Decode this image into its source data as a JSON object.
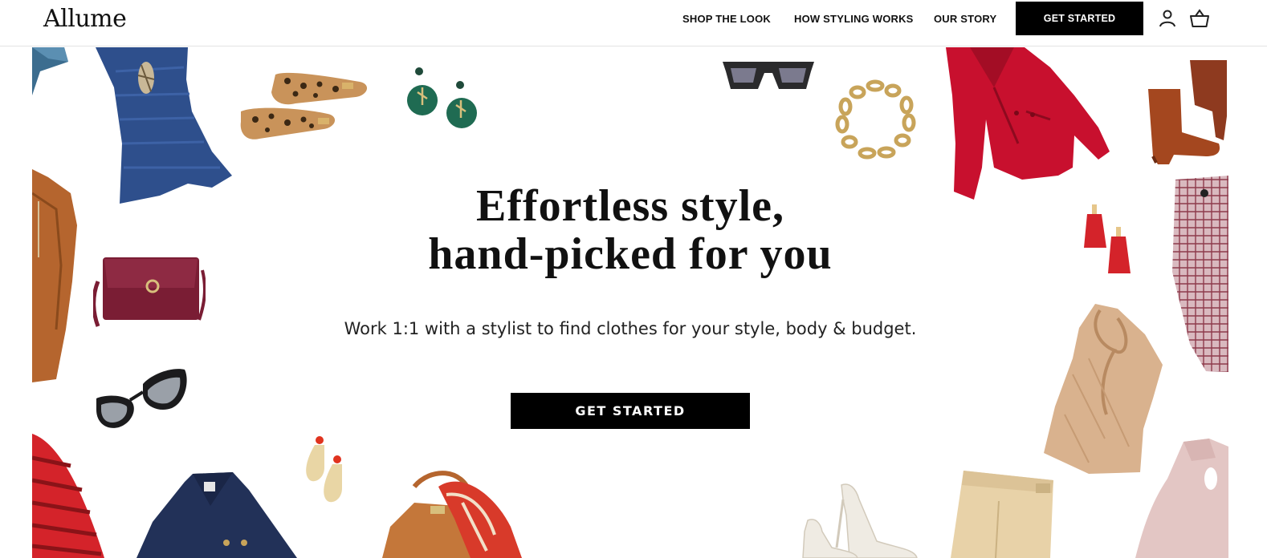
{
  "brand": {
    "logo_text": "Allume"
  },
  "nav": {
    "items": [
      {
        "label": "SHOP THE LOOK"
      },
      {
        "label": "HOW STYLING WORKS"
      },
      {
        "label": "OUR STORY"
      }
    ],
    "cta_label": "GET STARTED",
    "icons": [
      "account-icon",
      "basket-icon"
    ]
  },
  "hero": {
    "title_line1": "Effortless style,",
    "title_line2": "hand-picked for you",
    "subtitle": "Work 1:1 with a stylist to find clothes for your style, body & budget.",
    "cta_label": "GET STARTED"
  },
  "colors": {
    "black": "#000000",
    "navy_top": "#2d4f8a",
    "red_jacket": "#c8102e",
    "bag_maroon": "#7a1d34",
    "camel": "#b5652e"
  },
  "products": [
    "blue-knit-peplum-top",
    "leopard-flats",
    "green-drop-earrings",
    "tortoise-sunglasses",
    "gold-chain-necklace",
    "red-blazer",
    "rust-ankle-boots",
    "plaid-pencil-skirt",
    "red-triangle-earrings",
    "tan-leather-jacket",
    "maroon-crossbody-bag",
    "cat-eye-sunglasses",
    "satin-bow-blouse",
    "red-striped-top",
    "navy-blazer",
    "gold-drop-earrings",
    "tan-tote-with-scarf",
    "white-pumps",
    "beige-trousers",
    "pink-keyhole-sweater",
    "denim-piece"
  ]
}
